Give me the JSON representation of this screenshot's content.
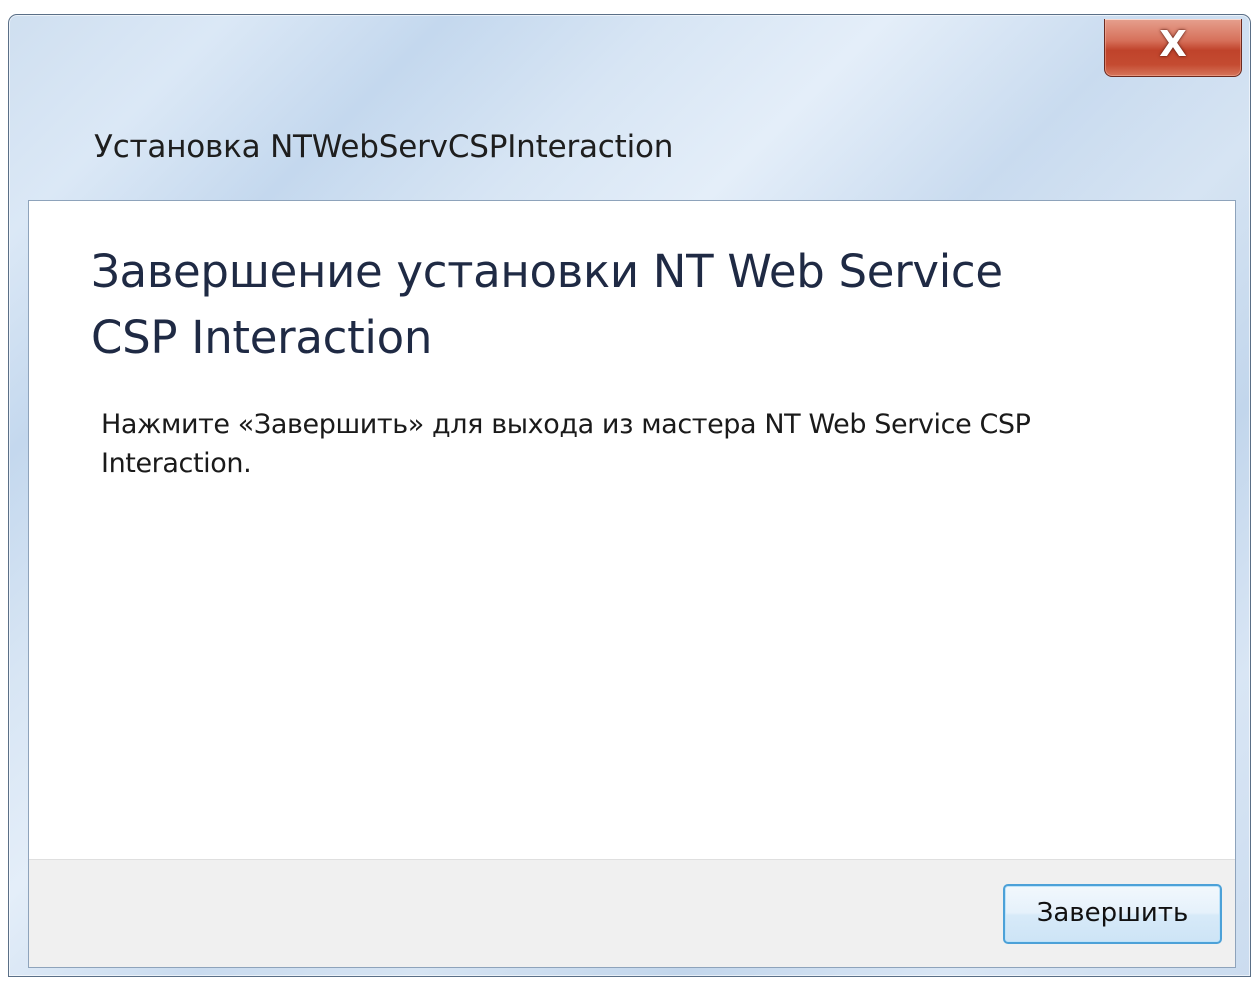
{
  "window": {
    "title": "Установка NTWebServCSPInteraction",
    "close_icon": "close-icon",
    "close_glyph": "X"
  },
  "content": {
    "heading": "Завершение установки NT Web Service CSP Interaction",
    "body": "Нажмите «Завершить» для выхода из мастера NT Web Service CSP Interaction."
  },
  "footer": {
    "finish_label": "Завершить"
  },
  "colors": {
    "close_button": "#c7472e",
    "accent_border": "#4ca1d8",
    "footer_bg": "#f0f0f0"
  }
}
